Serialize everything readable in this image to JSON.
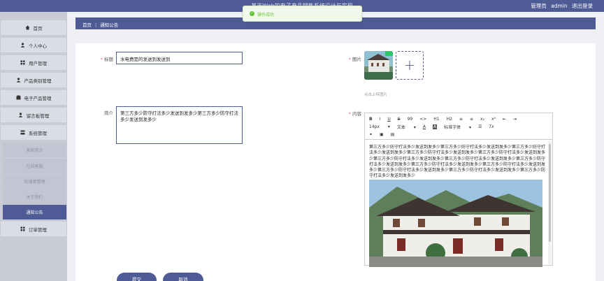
{
  "header": {
    "title": "基于Web的电子产品销售系统设计与实现",
    "role_label": "管理员",
    "username": "admin",
    "logout_label": "退出登录"
  },
  "toast": {
    "message": "操作成功"
  },
  "sidebar": {
    "items": [
      {
        "label": "首页",
        "icon": "home-icon"
      },
      {
        "label": "个人中心",
        "icon": "user-icon"
      },
      {
        "label": "用户管理",
        "icon": "grid-icon"
      },
      {
        "label": "产品类别管理",
        "icon": "user-icon"
      },
      {
        "label": "电子产品管理",
        "icon": "box-icon"
      },
      {
        "label": "留言板管理",
        "icon": "user-icon"
      },
      {
        "label": "系统管理",
        "icon": "settings-icon"
      }
    ],
    "sub_items": [
      {
        "label": "系统简介"
      },
      {
        "label": "在线客服"
      },
      {
        "label": "轮播图管理"
      },
      {
        "label": "关于我们"
      },
      {
        "label": "通知公告"
      }
    ],
    "bottom_item": {
      "label": "订单管理",
      "icon": "grid-icon"
    }
  },
  "breadcrumb": {
    "home": "首页",
    "current": "通知公告"
  },
  "form": {
    "title_label": "标题",
    "title_value": "水电费是的发送到发送到",
    "intro_label": "简介",
    "intro_value": "第三方多少防守打法多少发送到发多少第三方多少防守打法多少发送到发多少",
    "image_label": "图片",
    "upload_tip": "点击上传图片",
    "content_label": "内容",
    "content_text": "第三方多少防守打法多少发送到发多少第三方多少防守打法多少发送到发多少第三方多少防守打法多少发送到发多少第三方多少防守打法多少发送到发多少第三方多少防守打法多少发送到发多少第三方多少防守打法多少发送到发多少第三方多少防守打法多少发送到发多少第三方多少防守打法多少发送到发多少第三方多少防守打法多少发送到发多少第三方多少防守打法多少发送到发多少第三方多少防守打法多少发送到发多少第三方多少防守打法多少发送到发多少第三方多少防守打法多少发送到发多少",
    "submit_label": "提交",
    "cancel_label": "取消"
  },
  "editor_toolbar": {
    "row1": [
      "B",
      "I",
      "U",
      "S",
      "99",
      "<>",
      "H1",
      "H2",
      "≡",
      "≡",
      "x₂",
      "x²",
      "⇤",
      "⇥"
    ],
    "font_size": "14px",
    "text_style": "文本",
    "font_family": "标准字体"
  },
  "colors": {
    "primary": "#4e5b95",
    "sidebar_bg": "#c9ccd7",
    "success": "#67c23a"
  }
}
